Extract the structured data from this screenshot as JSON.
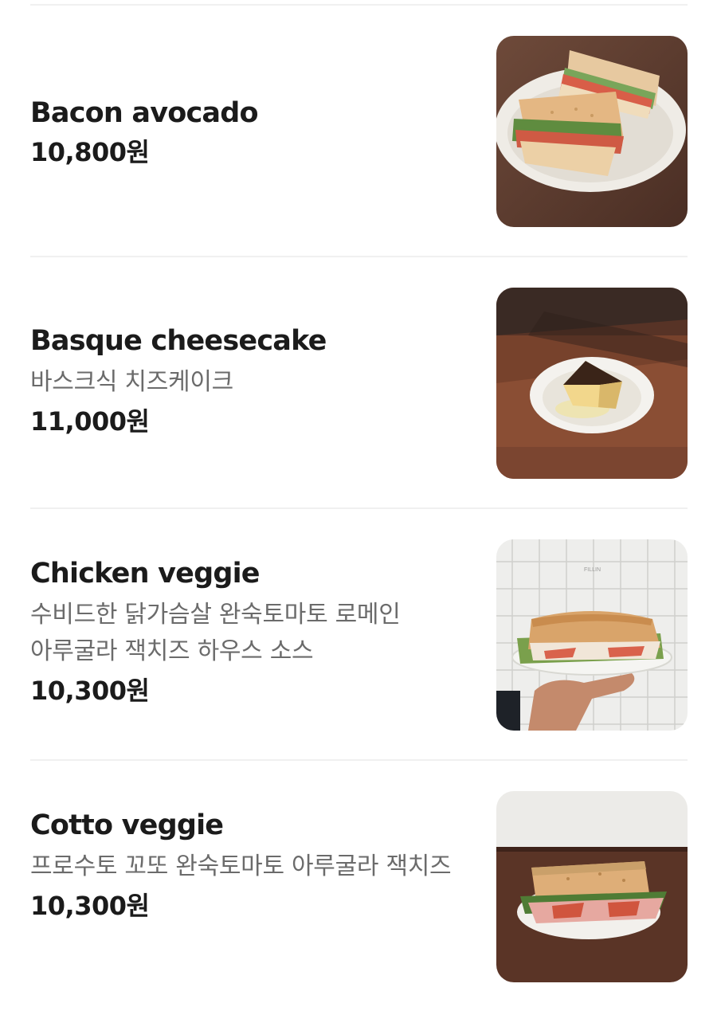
{
  "menu": {
    "items": [
      {
        "name": "Bacon avocado",
        "description": "",
        "price": "10,800원",
        "photo": "bacon-avocado-sandwich-photo"
      },
      {
        "name": "Basque cheesecake",
        "description": "바스크식 치즈케이크",
        "price": "11,000원",
        "photo": "basque-cheesecake-photo"
      },
      {
        "name": "Chicken veggie",
        "description": "수비드한 닭가슴살 완숙토마토 로메인 아루굴라 잭치즈 하우스 소스",
        "price": "10,300원",
        "photo": "chicken-veggie-sandwich-photo",
        "photo_sign": "FILLIN"
      },
      {
        "name": "Cotto veggie",
        "description": "프로수토 꼬또 완숙토마토 아루굴라 잭치즈",
        "price": "10,300원",
        "photo": "cotto-veggie-sandwich-photo"
      }
    ]
  }
}
